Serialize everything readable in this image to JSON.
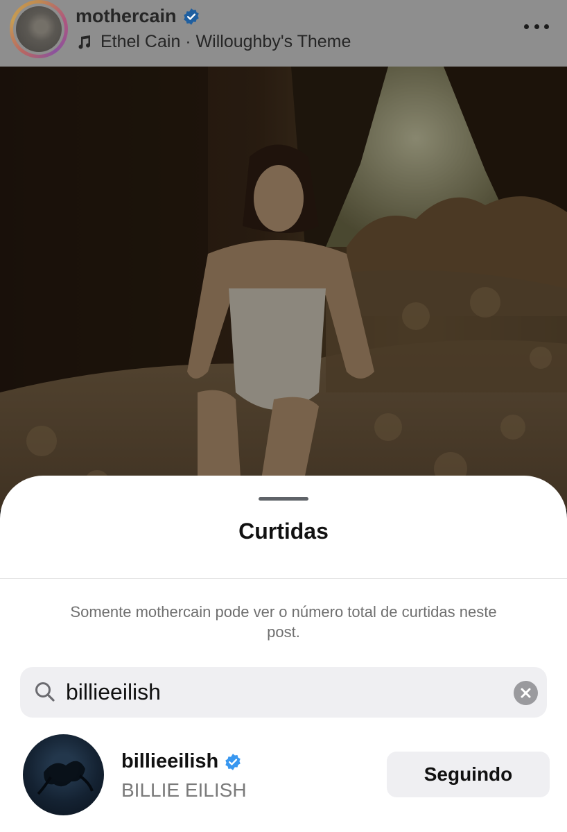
{
  "post_header": {
    "username": "mothercain",
    "song": "Ethel Cain · Willoughby's Theme",
    "avatar_icon": "profile-photo",
    "verified_icon": "verified-badge-icon",
    "music_icon": "music-note-icon",
    "more_icon": "more-options-icon"
  },
  "likes_sheet": {
    "title": "Curtidas",
    "notice": "Somente mothercain pode ver o número total de curtidas neste post.",
    "search": {
      "value": "billieeilish",
      "icon": "search-icon",
      "clear_icon": "clear-icon"
    },
    "results": [
      {
        "username": "billieeilish",
        "full_name": "BILLIE EILISH",
        "verified": true,
        "button_label": "Seguindo"
      }
    ]
  },
  "colors": {
    "verified_blue": "#3897f0",
    "sheet_background": "#ffffff",
    "secondary_text": "#6f6f6f",
    "button_background": "#efeff2"
  }
}
